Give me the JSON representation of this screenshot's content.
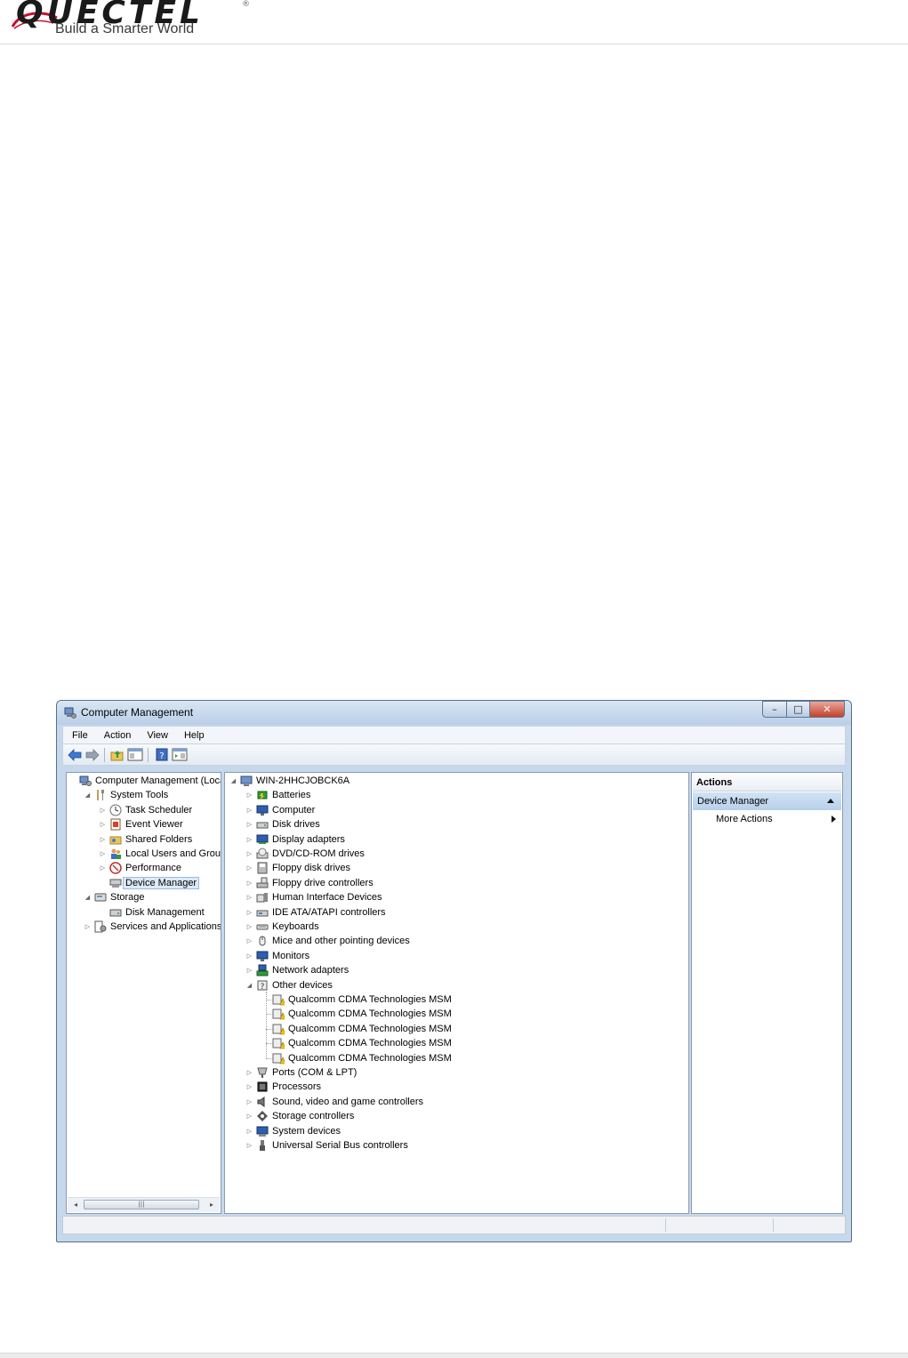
{
  "document": {
    "logo_text": "QUECTEL",
    "logo_mark": "®",
    "tagline": "Build a Smarter World"
  },
  "window": {
    "title": "Computer Management",
    "buttons": {
      "minimize": "–",
      "maximize": "□",
      "close": "✕"
    },
    "menu": [
      "File",
      "Action",
      "View",
      "Help"
    ],
    "toolbar_icons": [
      "back-arrow-icon",
      "forward-arrow-icon",
      "up-folder-icon",
      "show-hide-console-tree-icon",
      "help-icon",
      "show-hide-action-pane-icon"
    ]
  },
  "left_tree": [
    {
      "label": "Computer Management (Local",
      "level": 0,
      "toggle": "",
      "icon": "computer-management-icon"
    },
    {
      "label": "System Tools",
      "level": 1,
      "toggle": "◢",
      "icon": "tools-icon"
    },
    {
      "label": "Task Scheduler",
      "level": 2,
      "toggle": "▷",
      "icon": "clock-icon"
    },
    {
      "label": "Event Viewer",
      "level": 2,
      "toggle": "▷",
      "icon": "event-viewer-icon"
    },
    {
      "label": "Shared Folders",
      "level": 2,
      "toggle": "▷",
      "icon": "shared-folder-icon"
    },
    {
      "label": "Local Users and Groups",
      "level": 2,
      "toggle": "▷",
      "icon": "users-icon"
    },
    {
      "label": "Performance",
      "level": 2,
      "toggle": "▷",
      "icon": "performance-icon"
    },
    {
      "label": "Device Manager",
      "level": 2,
      "toggle": "",
      "icon": "device-manager-icon",
      "selected": true
    },
    {
      "label": "Storage",
      "level": 1,
      "toggle": "◢",
      "icon": "storage-icon"
    },
    {
      "label": "Disk Management",
      "level": 2,
      "toggle": "",
      "icon": "disk-icon"
    },
    {
      "label": "Services and Applications",
      "level": 1,
      "toggle": "▷",
      "icon": "services-icon"
    }
  ],
  "device_tree": [
    {
      "label": "WIN-2HHCJOBCK6A",
      "level": 0,
      "toggle": "◢",
      "icon": "computer-icon"
    },
    {
      "label": "Batteries",
      "level": 1,
      "toggle": "▷",
      "icon": "battery-icon"
    },
    {
      "label": "Computer",
      "level": 1,
      "toggle": "▷",
      "icon": "monitor-icon"
    },
    {
      "label": "Disk drives",
      "level": 1,
      "toggle": "▷",
      "icon": "disk-drive-icon"
    },
    {
      "label": "Display adapters",
      "level": 1,
      "toggle": "▷",
      "icon": "display-adapter-icon"
    },
    {
      "label": "DVD/CD-ROM drives",
      "level": 1,
      "toggle": "▷",
      "icon": "dvd-icon"
    },
    {
      "label": "Floppy disk drives",
      "level": 1,
      "toggle": "▷",
      "icon": "floppy-icon"
    },
    {
      "label": "Floppy drive controllers",
      "level": 1,
      "toggle": "▷",
      "icon": "controller-icon"
    },
    {
      "label": "Human Interface Devices",
      "level": 1,
      "toggle": "▷",
      "icon": "hid-icon"
    },
    {
      "label": "IDE ATA/ATAPI controllers",
      "level": 1,
      "toggle": "▷",
      "icon": "ide-icon"
    },
    {
      "label": "Keyboards",
      "level": 1,
      "toggle": "▷",
      "icon": "keyboard-icon"
    },
    {
      "label": "Mice and other pointing devices",
      "level": 1,
      "toggle": "▷",
      "icon": "mouse-icon"
    },
    {
      "label": "Monitors",
      "level": 1,
      "toggle": "▷",
      "icon": "monitor-icon"
    },
    {
      "label": "Network adapters",
      "level": 1,
      "toggle": "▷",
      "icon": "network-icon"
    },
    {
      "label": "Other devices",
      "level": 1,
      "toggle": "◢",
      "icon": "unknown-device-icon"
    },
    {
      "label": "Qualcomm CDMA Technologies MSM",
      "level": 2,
      "toggle": "",
      "icon": "warning-device-icon"
    },
    {
      "label": "Qualcomm CDMA Technologies MSM",
      "level": 2,
      "toggle": "",
      "icon": "warning-device-icon"
    },
    {
      "label": "Qualcomm CDMA Technologies MSM",
      "level": 2,
      "toggle": "",
      "icon": "warning-device-icon"
    },
    {
      "label": "Qualcomm CDMA Technologies MSM",
      "level": 2,
      "toggle": "",
      "icon": "warning-device-icon"
    },
    {
      "label": "Qualcomm CDMA Technologies MSM",
      "level": 2,
      "toggle": "",
      "icon": "warning-device-icon"
    },
    {
      "label": "Ports (COM & LPT)",
      "level": 1,
      "toggle": "▷",
      "icon": "port-icon"
    },
    {
      "label": "Processors",
      "level": 1,
      "toggle": "▷",
      "icon": "processor-icon"
    },
    {
      "label": "Sound, video and game controllers",
      "level": 1,
      "toggle": "▷",
      "icon": "speaker-icon"
    },
    {
      "label": "Storage controllers",
      "level": 1,
      "toggle": "▷",
      "icon": "storage-controller-icon"
    },
    {
      "label": "System devices",
      "level": 1,
      "toggle": "▷",
      "icon": "system-device-icon"
    },
    {
      "label": "Universal Serial Bus controllers",
      "level": 1,
      "toggle": "▷",
      "icon": "usb-icon"
    }
  ],
  "actions": {
    "header": "Actions",
    "section": "Device Manager",
    "more": "More Actions"
  },
  "scrollbar": {
    "left": "◂",
    "right": "▸",
    "grip": "|||"
  }
}
